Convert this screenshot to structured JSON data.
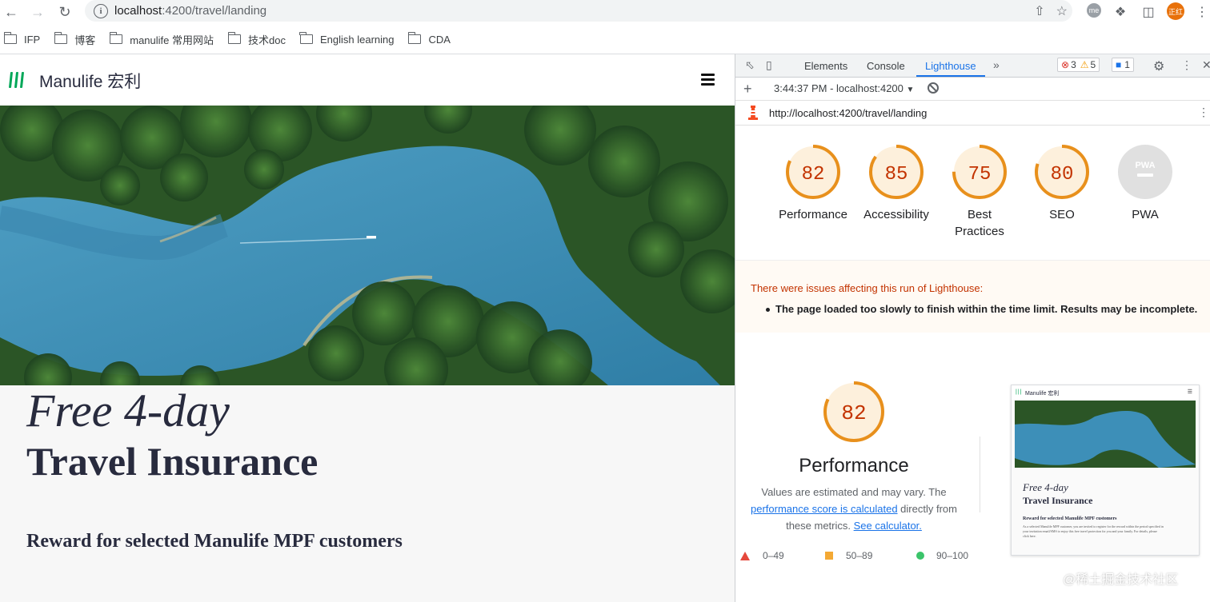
{
  "browser": {
    "url_host": "localhost",
    "url_rest": ":4200/travel/landing",
    "avatar_text": "正红",
    "me_text": "me"
  },
  "bookmarks": [
    {
      "label": "IFP"
    },
    {
      "label": "博客"
    },
    {
      "label": "manulife 常用网站"
    },
    {
      "label": "技术doc"
    },
    {
      "label": "English learning"
    },
    {
      "label": "CDA"
    }
  ],
  "site": {
    "logo_text": "Manulife 宏利",
    "headline_italic": "Free 4-day",
    "headline_bold": "Travel Insurance",
    "subheading": "Reward for selected Manulife MPF customers"
  },
  "devtools": {
    "tabs": [
      "Elements",
      "Console",
      "Lighthouse"
    ],
    "active_tab": "Lighthouse",
    "errors": "3",
    "warnings": "5",
    "messages": "1",
    "report_time": "3:44:37 PM - localhost:4200",
    "report_url": "http://localhost:4200/travel/landing"
  },
  "scores": [
    {
      "value": 82,
      "label": "Performance"
    },
    {
      "value": 85,
      "label": "Accessibility"
    },
    {
      "value": 75,
      "label": "Best Practices"
    },
    {
      "value": 80,
      "label": "SEO"
    },
    {
      "value": null,
      "label": "PWA",
      "badge": "PWA"
    }
  ],
  "warning": {
    "title": "There were issues affecting this run of Lighthouse:",
    "item": "The page loaded too slowly to finish within the time limit. Results may be incomplete."
  },
  "performance": {
    "score": 82,
    "title": "Performance",
    "desc_before": "Values are estimated and may vary. The",
    "desc_link": "performance score is calculated",
    "desc_middle": "directly from these metrics.",
    "desc_link2": "See calculator."
  },
  "legend": [
    {
      "range": "0–49",
      "color": "#e5483c"
    },
    {
      "range": "50–89",
      "color": "#f4a934"
    },
    {
      "range": "90–100",
      "color": "#3bc46a"
    }
  ],
  "thumbnail": {
    "logo_text": "Manulife 宏利",
    "headline_italic": "Free 4-day",
    "headline_bold": "Travel Insurance",
    "subheading": "Reward for selected Manulife MPF customers",
    "body": "As a selected Manulife MPF customer, you are invited to register for the reward within the period specified in your invitation email/SMS to enjoy this free travel protection for you and your family. For details, please click here."
  },
  "watermark": "@稀土掘金技术社区",
  "colors": {
    "score_orange": "#e8901c",
    "score_track": "#fdf0dc",
    "manulife_green": "#00a758"
  }
}
